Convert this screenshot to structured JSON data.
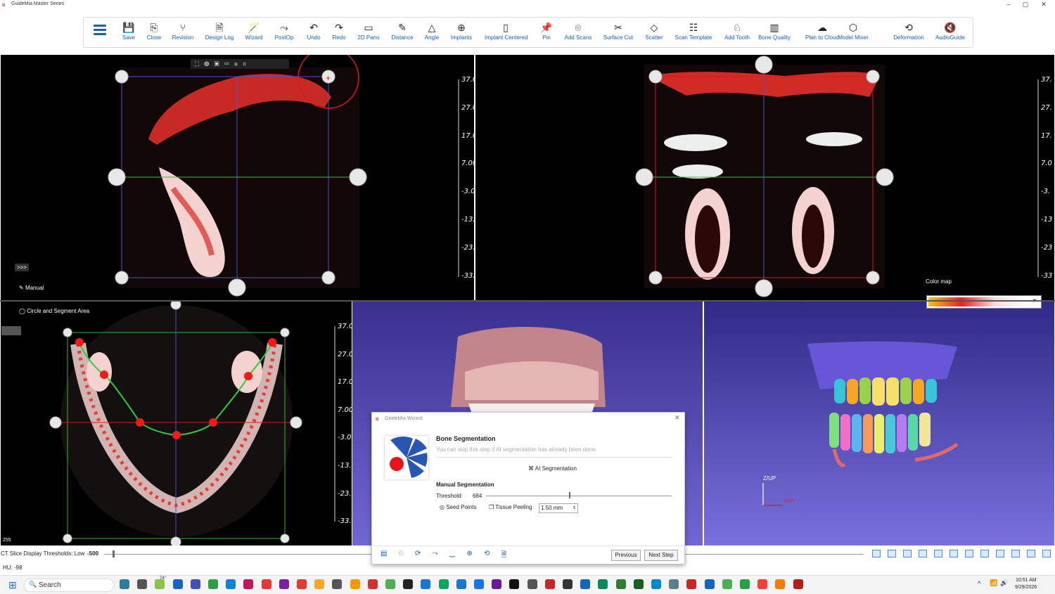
{
  "window": {
    "title": "GuideMia Master Series",
    "controls": [
      "–",
      "▢",
      "✕"
    ]
  },
  "toolbar": {
    "items": [
      {
        "label": "Save",
        "icon": "💾"
      },
      {
        "label": "Close",
        "icon": "⎘"
      },
      {
        "label": "Revision",
        "icon": "⑂"
      },
      {
        "label": "Design Log",
        "icon": "🗎"
      },
      {
        "label": "Wizard",
        "icon": "🪄"
      },
      {
        "label": "PostOp",
        "icon": "⤳"
      },
      {
        "label": "Undo",
        "icon": "↶"
      },
      {
        "label": "Redo",
        "icon": "↷"
      },
      {
        "label": "2D Pano",
        "icon": "▭"
      },
      {
        "label": "Distance",
        "icon": "✎"
      },
      {
        "label": "Angle",
        "icon": "△"
      },
      {
        "label": "Implants",
        "icon": "⊕"
      },
      {
        "label": "Implant Centered",
        "icon": "▯"
      },
      {
        "label": "Pin",
        "icon": "📌"
      },
      {
        "label": "Add Scans",
        "icon": "⌾"
      },
      {
        "label": "Surface Cut",
        "icon": "✂"
      },
      {
        "label": "Scatter",
        "icon": "◇"
      },
      {
        "label": "Scan Template",
        "icon": "☷"
      },
      {
        "label": "Add Tooth",
        "icon": "♘"
      },
      {
        "label": "Bone Quality",
        "icon": "▥"
      },
      {
        "label": "Plan to Cloud",
        "icon": "☁"
      },
      {
        "label": "Model Mixer",
        "icon": "⬡"
      },
      {
        "label": "Deformation",
        "icon": "⟲"
      },
      {
        "label": "AudioGuide",
        "icon": "🔇"
      }
    ]
  },
  "viewports": {
    "sagittal_ruler": [
      "37.0",
      "27.0",
      "17.0",
      "7.00",
      "-3.0",
      "-13.",
      "-23.",
      "-33."
    ],
    "coronal_ruler": [
      "37.",
      "27.",
      "17.",
      "7.0",
      "-3.",
      "-13",
      "-23",
      "-33"
    ],
    "axial_ruler": [
      "37.0",
      "27.0",
      "17.0",
      "7.00",
      "-3.0",
      "-13.",
      "-23.",
      "-33."
    ],
    "expand_label": ">>>",
    "manual_label": "Manual",
    "circle_segment_label": "Circle and Segment Area",
    "axial_corner": "255",
    "color_map_label": "Color map",
    "axis_up": "Z/UP",
    "axis_rt": "X/RT"
  },
  "status": {
    "threshold_label": "CT Slice Display Thresholds: Low",
    "threshold_low": "-500",
    "hu": "HU: -98"
  },
  "wizard": {
    "title": "GuideMia Wizard",
    "heading": "Bone Segmentation",
    "hint": "You can skip this step if AI segmentation has already been done.",
    "ai_button": "AI Segmentation",
    "manual_heading": "Manual Segmentation",
    "threshold_label": "Threshold:",
    "threshold_value": "684",
    "threshold_fraction": 0.45,
    "seed_points": "Seed Points",
    "tissue_peeling": "Tissue Peeling",
    "peeling_value": "1.50 mm",
    "previous": "Previous",
    "next": "Next Step"
  },
  "taskbar": {
    "search": "Search",
    "weather": "74°",
    "time": "10:51 AM",
    "date": "9/29/2026"
  },
  "colors": {
    "accent": "#1e5bb8",
    "bone": "#e8302a",
    "annotation": "#d8191e",
    "viewport_3d": "#6a63c9"
  }
}
